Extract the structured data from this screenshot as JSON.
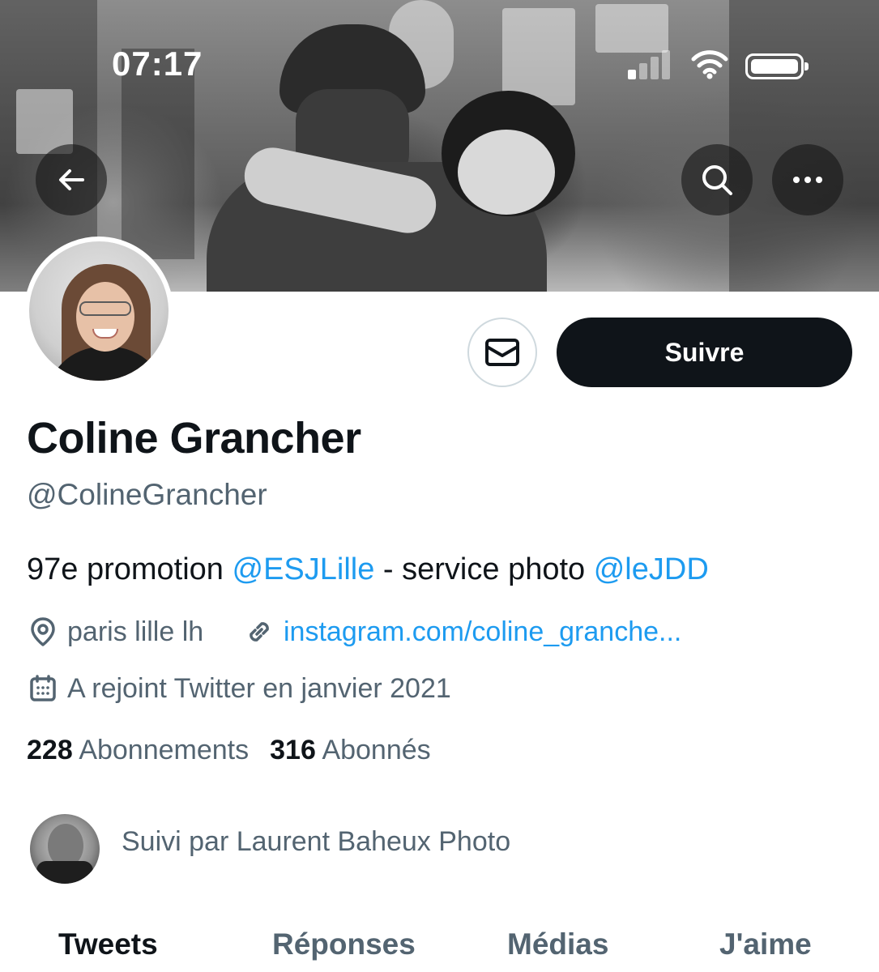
{
  "status_bar": {
    "time": "07:17",
    "icons": [
      "cellular-signal-icon",
      "wifi-icon",
      "battery-icon"
    ]
  },
  "header": {
    "back_icon": "arrow-left-icon",
    "search_icon": "search-icon",
    "more_icon": "more-horizontal-icon"
  },
  "profile": {
    "name": "Coline Grancher",
    "handle": "@ColineGrancher",
    "bio": {
      "part1": "97e promotion ",
      "mention1": "@ESJLille",
      "part2": " - service photo ",
      "mention2": "@leJDD"
    },
    "location": "paris lille lh",
    "website": "instagram.com/coline_granche...",
    "joined": "A rejoint Twitter en janvier 2021",
    "following_count": "228",
    "following_label": "Abonnements",
    "followers_count": "316",
    "followers_label": "Abonnés"
  },
  "actions": {
    "message_icon": "envelope-icon",
    "follow_label": "Suivre"
  },
  "followed_by": {
    "text": "Suivi par Laurent Baheux Photo"
  },
  "tabs": [
    {
      "label": "Tweets",
      "active": true
    },
    {
      "label": "Réponses",
      "active": false
    },
    {
      "label": "Médias",
      "active": false
    },
    {
      "label": "J'aime",
      "active": false
    }
  ],
  "colors": {
    "accent": "#1d9bf0",
    "text_primary": "#0f1419",
    "text_secondary": "#536471",
    "follow_button_bg": "#0f1419"
  }
}
